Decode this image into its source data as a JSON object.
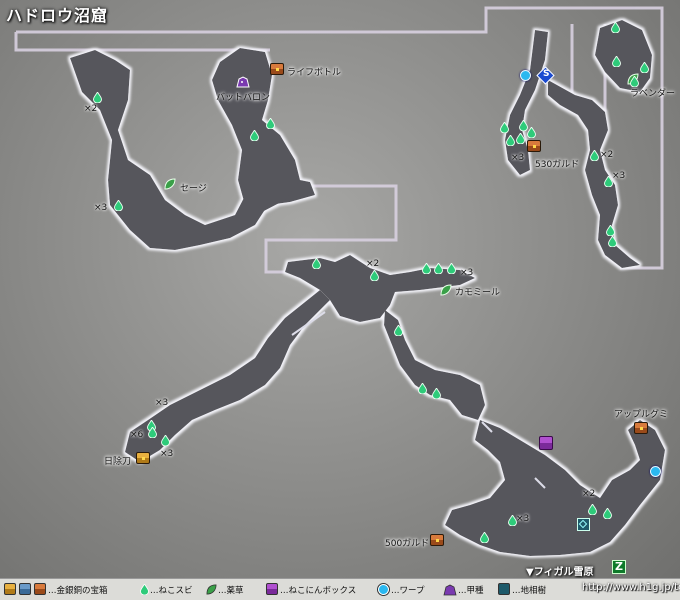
{
  "title": "ハドロウ沼窟",
  "labels": {
    "life_bottle": "ライフボトル",
    "bat_balloon": "バットバロン",
    "sage": "セージ",
    "lavender": "ラベンダー",
    "gald_530": "530ガルド",
    "camomile": "カモミール",
    "apple_gummy": "アップルグミ",
    "hiyokebi": "日除刀",
    "gald_500": "500ガルド",
    "exit": "▼フィガル雪原"
  },
  "counts": {
    "nw_x2": "×2",
    "nw_x3": "×3",
    "ne_x2": "×2",
    "ne_x3": "×3",
    "ne_530_x3": "×3",
    "c_x2": "×2",
    "c_x3": "×3",
    "sw_x3_a": "×3",
    "sw_x6": "×6",
    "sw_x3_b": "×3",
    "se_x2": "×2",
    "se_x3": "×3"
  },
  "legend": {
    "chest": "…金銀銅の宝箱",
    "drop": "…ねこスビ",
    "herb": "…薬草",
    "nekonin": "…ねこにんボックス",
    "warp": "…ワープ",
    "enemy": "…甲種",
    "tree": "…地相樹",
    "credit": "http://www.h1g.jp/tob/"
  },
  "icons": {
    "drop": "green-drop-icon",
    "herb": "green-leaf-icon",
    "chest": "treasure-chest-icon",
    "warp": "cyan-circle-icon",
    "save": "save-point-icon",
    "tree": "earth-tree-icon",
    "enemy": "purple-beast-icon",
    "nekonin": "purple-box-icon",
    "exit": "exit-arrow-icon"
  },
  "colors": {
    "cave": "#57565c",
    "cave_glow": "#e8e8f0",
    "drop": "#2ecb7a",
    "herb": "#3aa048",
    "warp": "#2ab8f0"
  }
}
